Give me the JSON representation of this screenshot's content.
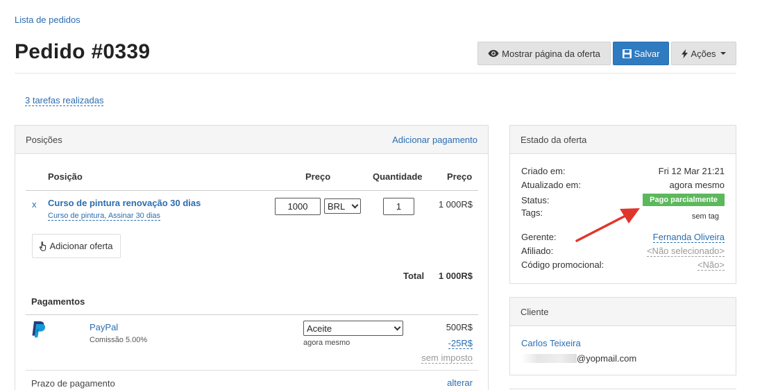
{
  "breadcrumb": "Lista de pedidos",
  "title": "Pedido #0339",
  "header_buttons": {
    "show_offer": "Mostrar página da oferta",
    "save": "Salvar",
    "actions": "Ações"
  },
  "tasks_link": "3 tarefas realizadas",
  "positions": {
    "heading": "Posições",
    "add_payment": "Adicionar pagamento",
    "columns": {
      "position": "Posição",
      "price": "Preço",
      "quantity": "Quantidade",
      "price_total": "Preço"
    },
    "item": {
      "remove": "x",
      "name": "Curso de pintura renovação 30 dias",
      "subtitle": "Curso de pintura, Assinar 30 dias",
      "price_value": "1000",
      "currency": "BRL",
      "quantity": "1",
      "total": "1 000R$"
    },
    "add_offer": "Adicionar oferta",
    "total_label": "Total",
    "total_value": "1 000R$"
  },
  "payments": {
    "heading": "Pagamentos",
    "method": "PayPal",
    "commission": "Comissão 5.00%",
    "status": "Aceite",
    "time": "agora mesmo",
    "amount": "500R$",
    "fee": "-25R$",
    "tax": "sem imposto"
  },
  "deadline": {
    "label": "Prazo de pagamento",
    "action": "alterar"
  },
  "offer_state": {
    "heading": "Estado da oferta",
    "created_label": "Criado em:",
    "created_value": "Fri 12 Mar 21:21",
    "updated_label": "Atualizado em:",
    "updated_value": "agora mesmo",
    "status_label": "Status:",
    "status_value": "Pago parcialmente",
    "tags_label": "Tags:",
    "tags_value": "sem tag",
    "manager_label": "Gerente:",
    "manager_value": "Fernanda Oliveira",
    "affiliate_label": "Afiliado:",
    "affiliate_value": "<Não selecionado>",
    "promo_label": "Código promocional:",
    "promo_value": "<Não>"
  },
  "client": {
    "heading": "Cliente",
    "name": "Carlos Teixeira",
    "email_suffix": "@yopmail.com"
  },
  "colors": {
    "accent": "#2f7bc0",
    "status": "#5cb85c",
    "arrow": "#e0352b"
  }
}
